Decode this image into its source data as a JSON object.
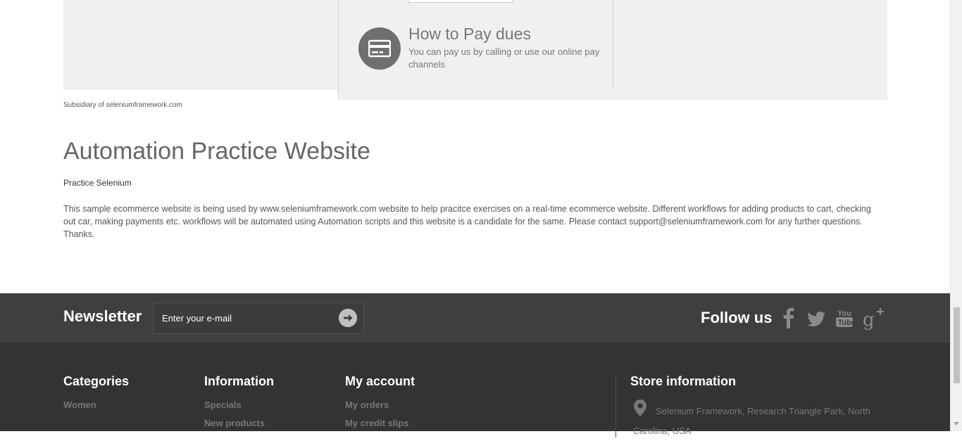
{
  "top_panel": {
    "pay_title": "How to Pay dues",
    "pay_text": "You can pay us by calling or use our online pay channels",
    "pay_icon": "credit-card-icon"
  },
  "subsidiary": "Subsidiary of seleniumframework.com",
  "content": {
    "title": "Automation Practice Website",
    "subtitle": "Practice Selenium",
    "description": "This sample ecommerce website is being used by www.seleniumframework.com website to help pracitce exercises on a real-time ecommerce website. Different workflows for adding products to cart, checking out car, making payments etc. workflows will be automated using Automation scripts and this website is a candidate for the same. Please contact support@seleniumframework.com for any further questions. Thanks."
  },
  "newsletter": {
    "title": "Newsletter",
    "placeholder": "Enter your e-mail",
    "submit_icon": "chevron-right-circle-icon"
  },
  "follow": {
    "title": "Follow us",
    "icons": [
      "facebook-icon",
      "twitter-icon",
      "youtube-icon",
      "google-plus-icon"
    ]
  },
  "footer": {
    "categories": {
      "title": "Categories",
      "links": [
        "Women"
      ]
    },
    "information": {
      "title": "Information",
      "links": [
        "Specials",
        "New products"
      ]
    },
    "account": {
      "title": "My account",
      "links": [
        "My orders",
        "My credit slips"
      ]
    },
    "store": {
      "title": "Store information",
      "address": "Selenium Framework, Research Triangle Park, North Carolina, USA"
    }
  },
  "colors": {
    "newsletter_bg": "#3f3f3f",
    "footer_bg": "#333333",
    "panel_bg": "#f0f0f0"
  }
}
